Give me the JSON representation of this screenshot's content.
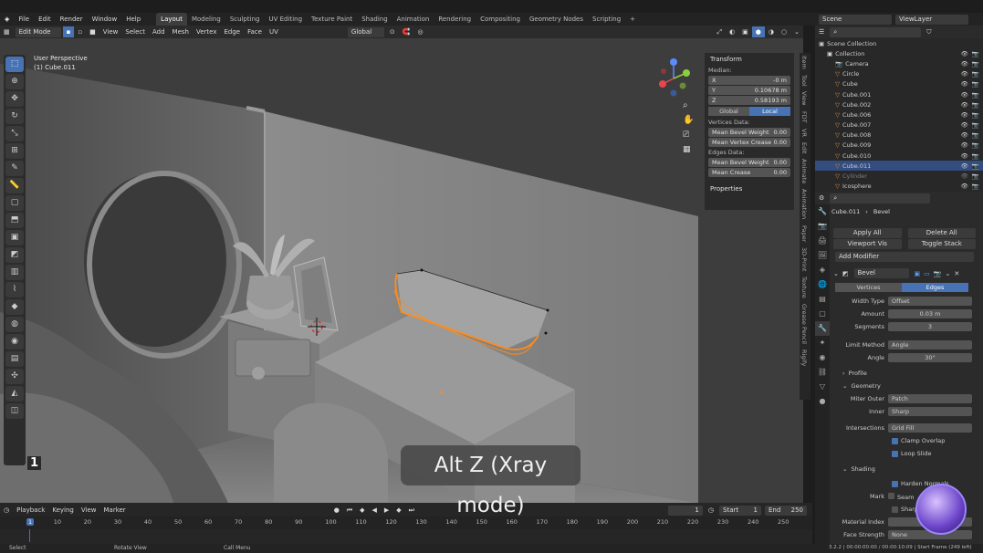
{
  "menu": {
    "items": [
      "File",
      "Edit",
      "Render",
      "Window",
      "Help"
    ]
  },
  "workspaces": [
    "Layout",
    "Modeling",
    "Sculpting",
    "UV Editing",
    "Texture Paint",
    "Shading",
    "Animation",
    "Rendering",
    "Compositing",
    "Geometry Nodes",
    "Scripting"
  ],
  "active_workspace": "Layout",
  "scene_field": "Scene",
  "viewlayer_field": "ViewLayer",
  "header3d": {
    "mode": "Edit Mode",
    "menus": [
      "View",
      "Select",
      "Add",
      "Mesh",
      "Vertex",
      "Edge",
      "Face",
      "UV"
    ],
    "transform_orientation": "Global",
    "options": "Options"
  },
  "viewport": {
    "view_name": "User Perspective",
    "object_name": "(1) Cube.011",
    "frame_marker": "1"
  },
  "npanel": {
    "transform_title": "Transform",
    "median_label": "Median:",
    "x_label": "X",
    "x_value": "-0 m",
    "y_label": "Y",
    "y_value": "0.10678 m",
    "z_label": "Z",
    "z_value": "0.58193 m",
    "global_label": "Global",
    "local_label": "Local",
    "vertices_data": "Vertices Data:",
    "mean_bevel_weight_label": "Mean Bevel Weight",
    "mean_bevel_weight_value": "0.00",
    "mean_vertex_crease_label": "Mean Vertex Crease",
    "mean_vertex_crease_value": "0.00",
    "edges_data": "Edges Data:",
    "edge_mean_bevel_weight_label": "Mean Bevel Weight",
    "edge_mean_bevel_weight_value": "0.00",
    "mean_crease_label": "Mean Crease",
    "mean_crease_value": "0.00",
    "properties_label": "Properties"
  },
  "sidetabs": [
    "Item",
    "Tool",
    "View",
    "FDT",
    "VR",
    "Edit",
    "Animate",
    "Animation",
    "Paper",
    "3D-Print",
    "Texture",
    "Grease Pencil",
    "Rigify"
  ],
  "outliner": {
    "title": "Scene Collection",
    "rows": [
      {
        "name": "Collection",
        "indent": 1
      },
      {
        "name": "Camera",
        "indent": 2
      },
      {
        "name": "Circle",
        "indent": 2
      },
      {
        "name": "Cube",
        "indent": 2
      },
      {
        "name": "Cube.001",
        "indent": 2
      },
      {
        "name": "Cube.002",
        "indent": 2
      },
      {
        "name": "Cube.006",
        "indent": 2
      },
      {
        "name": "Cube.007",
        "indent": 2
      },
      {
        "name": "Cube.008",
        "indent": 2
      },
      {
        "name": "Cube.009",
        "indent": 2
      },
      {
        "name": "Cube.010",
        "indent": 2
      },
      {
        "name": "Cube.011",
        "indent": 2,
        "selected": true
      },
      {
        "name": "Cylinder",
        "indent": 2,
        "dim": true
      },
      {
        "name": "Icosphere",
        "indent": 2
      }
    ]
  },
  "props": {
    "object": "Cube.011",
    "modifier_tab": "Bevel",
    "apply_all": "Apply All",
    "delete_all": "Delete All",
    "viewport_vis": "Viewport Vis",
    "toggle_stack": "Toggle Stack",
    "add_modifier": "Add Modifier",
    "modifier_name": "Bevel",
    "vertices": "Vertices",
    "edges": "Edges",
    "width_type_label": "Width Type",
    "width_type": "Offset",
    "amount_label": "Amount",
    "amount": "0.03 m",
    "segments_label": "Segments",
    "segments": "3",
    "limit_method_label": "Limit Method",
    "limit_method": "Angle",
    "angle_label": "Angle",
    "angle": "30°",
    "profile": "Profile",
    "geometry": "Geometry",
    "miter_outer_label": "Miter Outer",
    "miter_outer": "Patch",
    "inner_label": "Inner",
    "inner": "Sharp",
    "intersections_label": "Intersections",
    "intersections": "Grid Fill",
    "clamp_overlap": "Clamp Overlap",
    "loop_slide": "Loop Slide",
    "shading": "Shading",
    "harden_normals": "Harden Normals",
    "mark_label": "Mark",
    "seam": "Seam",
    "sharp": "Sharp",
    "material_index_label": "Material Index",
    "face_strength_label": "Face Strength",
    "face_strength": "None"
  },
  "timeline": {
    "menus": [
      "Playback",
      "Keying",
      "View",
      "Marker"
    ],
    "current_frame": "1",
    "start_label": "Start",
    "start": "1",
    "end_label": "End",
    "end": "250",
    "ticks": [
      "1",
      "10",
      "20",
      "30",
      "40",
      "50",
      "60",
      "70",
      "80",
      "90",
      "100",
      "110",
      "120",
      "130",
      "140",
      "150",
      "160",
      "170",
      "180",
      "190",
      "200",
      "210",
      "220",
      "230",
      "240",
      "250"
    ]
  },
  "status": {
    "select": "Select",
    "rotate": "Rotate View",
    "call_menu": "Call Menu",
    "right": "3.2.2 | 00:00:00:00 / 00:00:10:09 | Start Frame (249 left)"
  },
  "caption": "Alt Z (Xray mode)",
  "colors": {
    "accent": "#4772b3",
    "selection": "#ff8c1a",
    "viewport": "#3d3d3d"
  }
}
